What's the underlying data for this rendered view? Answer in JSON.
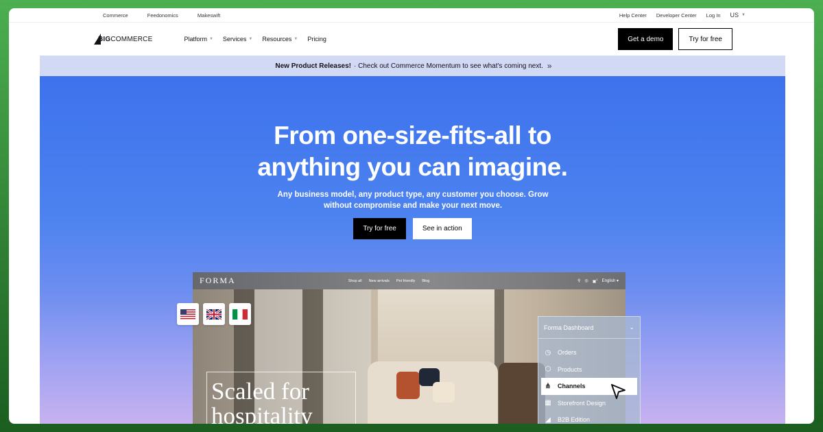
{
  "utility_bar": {
    "left_links": [
      "Commerce",
      "Feedonomics",
      "Makeswift"
    ],
    "right_links": [
      "Help Center",
      "Developer Center",
      "Log In"
    ],
    "region": "US"
  },
  "nav": {
    "logo_big": "BIG",
    "logo_rest": "COMMERCE",
    "items": [
      {
        "label": "Platform",
        "dropdown": true
      },
      {
        "label": "Services",
        "dropdown": true
      },
      {
        "label": "Resources",
        "dropdown": true
      },
      {
        "label": "Pricing",
        "dropdown": false
      }
    ],
    "demo_button": "Get a demo",
    "try_button": "Try for free"
  },
  "announcement": {
    "bold": "New Product Releases!",
    "text": "· Check out Commerce Momentum to see what's coming next.",
    "chevron": "»"
  },
  "hero": {
    "title_line1": "From one-size-fits-all to",
    "title_line2": "anything you can imagine.",
    "subtitle_line1": "Any business model, any product type, any customer you choose. Grow",
    "subtitle_line2": "without compromise and make your next move.",
    "cta_primary": "Try for free",
    "cta_secondary": "See in action",
    "colors": {
      "hero_top": "#3d72ed",
      "hero_bottom": "#c8b2f0",
      "announce_bg": "#d1d9f5"
    }
  },
  "mockup": {
    "brand": "FORMA",
    "links": [
      "Shop all",
      "New arrivals",
      "Pet friendly",
      "Blog"
    ],
    "language": "English",
    "cart_count": "1",
    "headline_line1": "Scaled for",
    "headline_line2": "hospitality",
    "flags": [
      "us-flag",
      "uk-flag",
      "italy-flag"
    ]
  },
  "dashboard": {
    "title": "Forma Dashboard",
    "items": [
      {
        "label": "Orders",
        "icon": "clock-icon",
        "active": false
      },
      {
        "label": "Products",
        "icon": "box-icon",
        "active": false
      },
      {
        "label": "Channels",
        "icon": "channels-icon",
        "active": true
      },
      {
        "label": "Storefront Design",
        "icon": "storefront-icon",
        "active": false
      },
      {
        "label": "B2B Edition",
        "icon": "b2b-icon",
        "active": false
      }
    ]
  }
}
